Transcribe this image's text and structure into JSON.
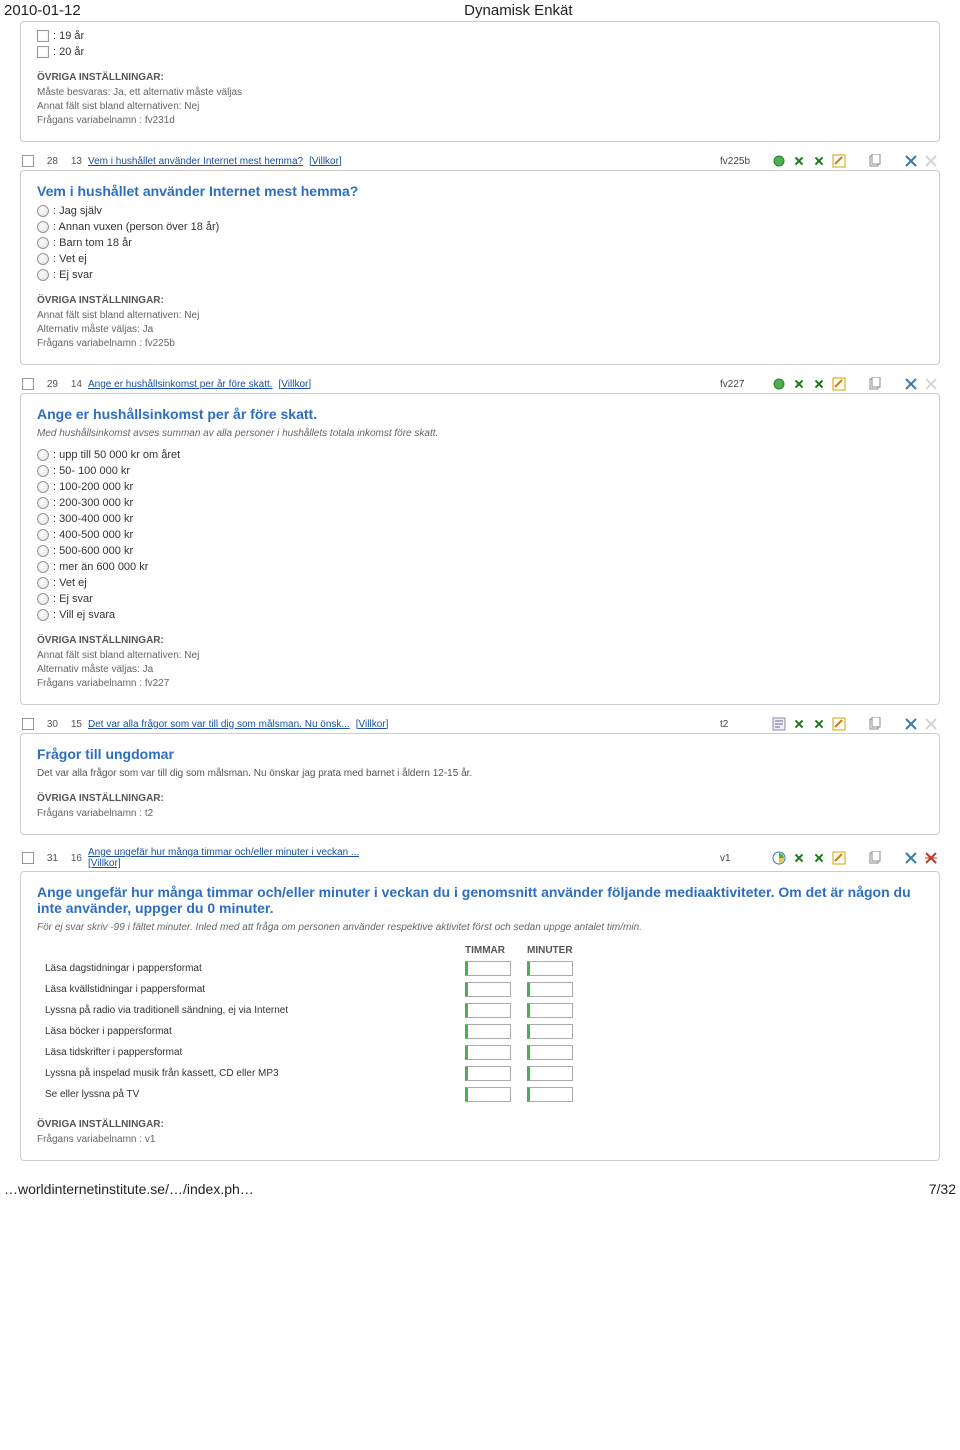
{
  "header": {
    "date": "2010-01-12",
    "title": "Dynamisk Enkät"
  },
  "panel_top": {
    "options": [
      ": 19 år",
      ": 20 år"
    ],
    "settings": {
      "heading": "ÖVRIGA INSTÄLLNINGAR:",
      "lines": [
        "Måste besvaras: Ja, ett alternativ måste väljas",
        "Annat fält sist bland alternativen: Nej",
        "Frågans variabelnamn : fv231d"
      ]
    }
  },
  "q28": {
    "n1": "28",
    "n2": "13",
    "link": "Vem i hushållet använder Internet mest hemma?",
    "cond": "[Villkor]",
    "var": "fv225b",
    "type": "radio"
  },
  "panel_q28": {
    "heading": "Vem i hushållet använder Internet mest hemma?",
    "options": [
      ": Jag själv",
      ": Annan vuxen (person över 18 år)",
      ": Barn tom 18 år",
      ": Vet ej",
      ": Ej svar"
    ],
    "settings": {
      "heading": "ÖVRIGA INSTÄLLNINGAR:",
      "lines": [
        "Annat fält sist bland alternativen: Nej",
        "Alternativ måste väljas: Ja",
        "Frågans variabelnamn : fv225b"
      ]
    }
  },
  "q29": {
    "n1": "29",
    "n2": "14",
    "link": "Ange er hushållsinkomst per år före skatt.",
    "cond": "[Villkor]",
    "var": "fv227",
    "type": "radio"
  },
  "panel_q29": {
    "heading": "Ange er hushållsinkomst per år före skatt.",
    "sub": "Med hushållsinkomst avses summan av alla personer i hushållets totala inkomst före skatt.",
    "options": [
      ": upp till 50 000 kr om året",
      ": 50- 100 000 kr",
      ": 100-200 000 kr",
      ": 200-300 000 kr",
      ": 300-400 000 kr",
      ": 400-500 000 kr",
      ": 500-600 000 kr",
      ": mer än 600 000 kr",
      ": Vet ej",
      ": Ej svar",
      ": Vill ej svara"
    ],
    "settings": {
      "heading": "ÖVRIGA INSTÄLLNINGAR:",
      "lines": [
        "Annat fält sist bland alternativen: Nej",
        "Alternativ måste väljas: Ja",
        "Frågans variabelnamn : fv227"
      ]
    }
  },
  "q30": {
    "n1": "30",
    "n2": "15",
    "link": "Det var alla frågor som var till dig som målsman. Nu önsk...",
    "cond": "[Villkor]",
    "var": "t2",
    "type": "info"
  },
  "panel_q30": {
    "heading": "Frågor till ungdomar",
    "sub": "Det var alla frågor som var till dig som målsman. Nu önskar jag prata med barnet i åldern 12-15 år.",
    "settings": {
      "heading": "ÖVRIGA INSTÄLLNINGAR:",
      "lines": [
        "Frågans variabelnamn : t2"
      ]
    }
  },
  "q31": {
    "n1": "31",
    "n2": "16",
    "link": "Ange ungefär hur många timmar och/eller minuter i veckan ...",
    "cond": "[Villkor]",
    "var": "v1",
    "type": "matrix"
  },
  "panel_q31": {
    "heading": "Ange ungefär hur många timmar och/eller minuter i veckan du i genomsnitt använder följande mediaaktiviteter. Om det är någon du inte använder, uppger du 0 minuter.",
    "sub": "För ej svar skriv -99 i fältet minuter. Inled med att fråga om personen använder respektive aktivitet först och sedan uppge antalet tim/min.",
    "col1": "TIMMAR",
    "col2": "MINUTER",
    "rows": [
      "Läsa dagstidningar i pappersformat",
      "Läsa kvällstidningar i pappersformat",
      "Lyssna på radio via traditionell sändning, ej via Internet",
      "Läsa böcker i pappersformat",
      "Läsa tidskrifter i pappersformat",
      "Lyssna på inspelad musik från kassett, CD eller MP3",
      "Se eller lyssna på TV"
    ],
    "settings": {
      "heading": "ÖVRIGA INSTÄLLNINGAR:",
      "lines": [
        "Frågans variabelnamn : v1"
      ]
    }
  },
  "footer": {
    "url": "…worldinternetinstitute.se/…/index.ph…",
    "page": "7/32"
  }
}
